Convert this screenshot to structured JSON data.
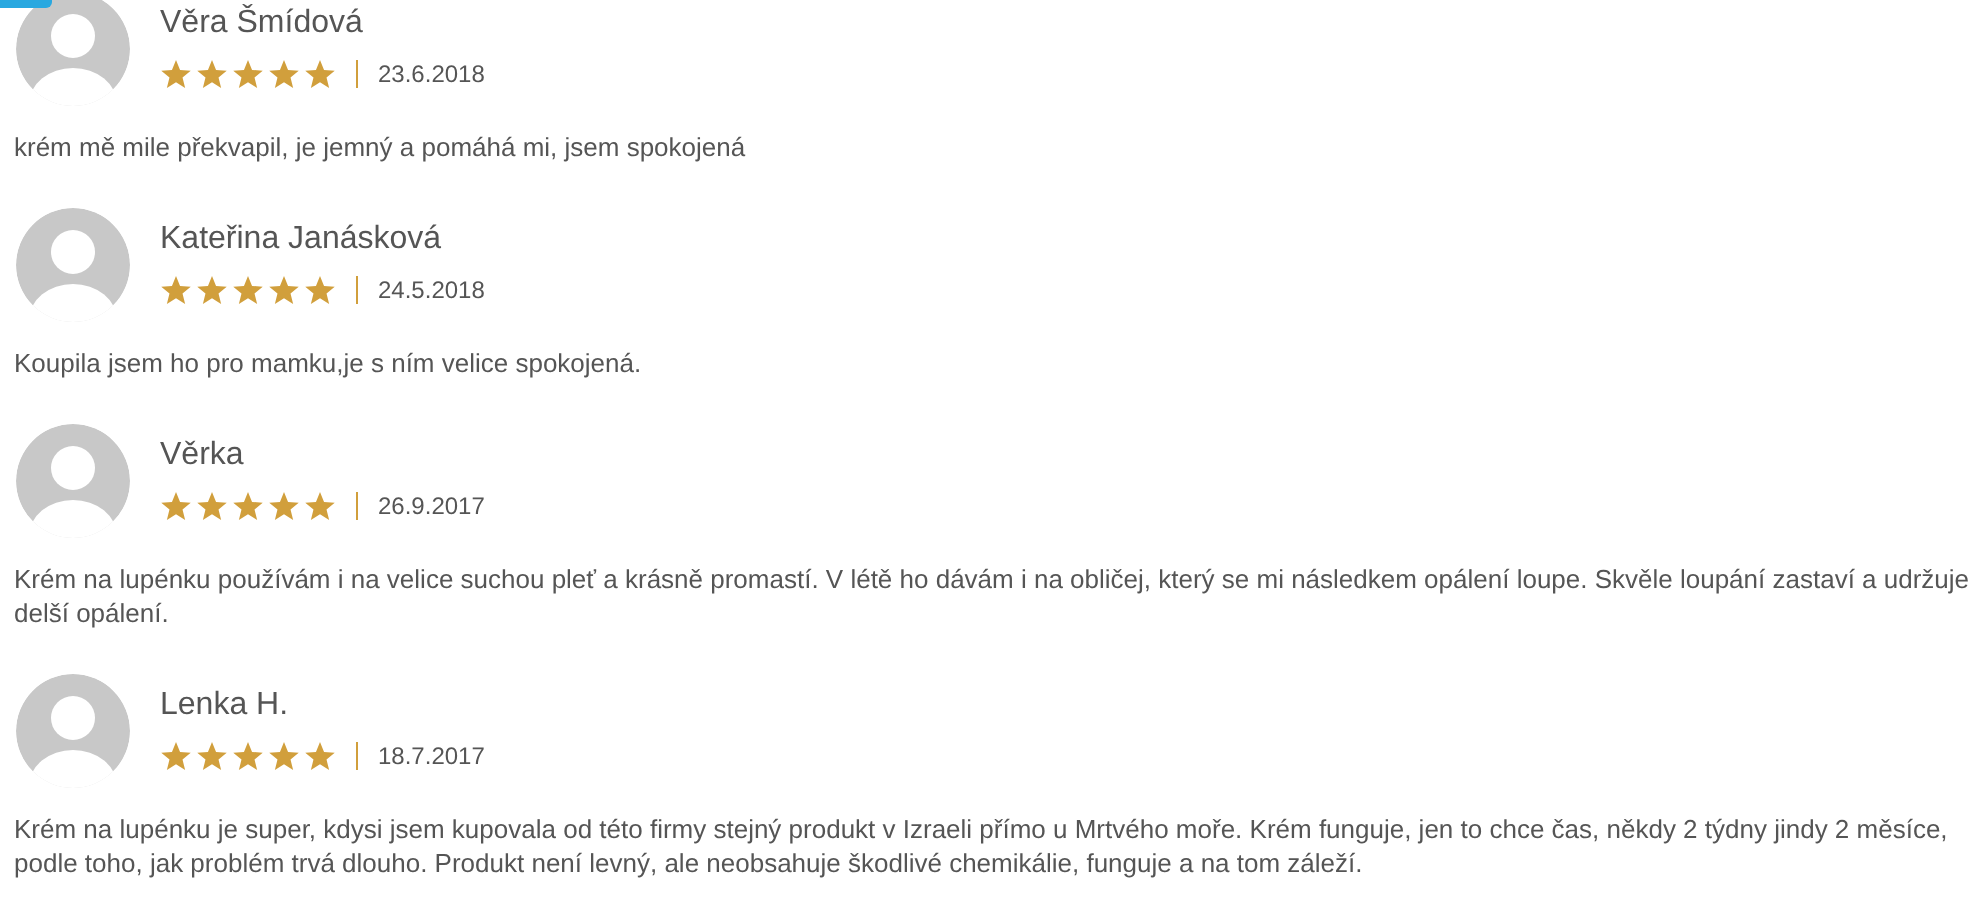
{
  "reviews": [
    {
      "name": "Věra Šmídová",
      "stars": 5,
      "date": "23.6.2018",
      "text": "krém mě mile překvapil, je jemný a pomáhá mi, jsem spokojená"
    },
    {
      "name": "Kateřina Janásková",
      "stars": 5,
      "date": "24.5.2018",
      "text": "Koupila jsem ho pro mamku,je s ním velice spokojená."
    },
    {
      "name": "Věrka",
      "stars": 5,
      "date": "26.9.2017",
      "text": "Krém na lupénku používám i na velice suchou pleť a krásně promastí. V létě ho dávám i na obličej, který se mi následkem opálení loupe. Skvěle loupání zastaví a udržuje delší opálení."
    },
    {
      "name": "Lenka H.",
      "stars": 5,
      "date": "18.7.2017",
      "text": "Krém na lupénku je super, kdysi jsem kupovala od této firmy stejný produkt v Izraeli přímo u Mrtvého moře. Krém funguje, jen to chce čas, někdy 2 týdny jindy 2 měsíce, podle toho, jak problém trvá dlouho. Produkt není levný, ale neobsahuje škodlivé chemikálie, funguje a na tom záleží."
    }
  ]
}
